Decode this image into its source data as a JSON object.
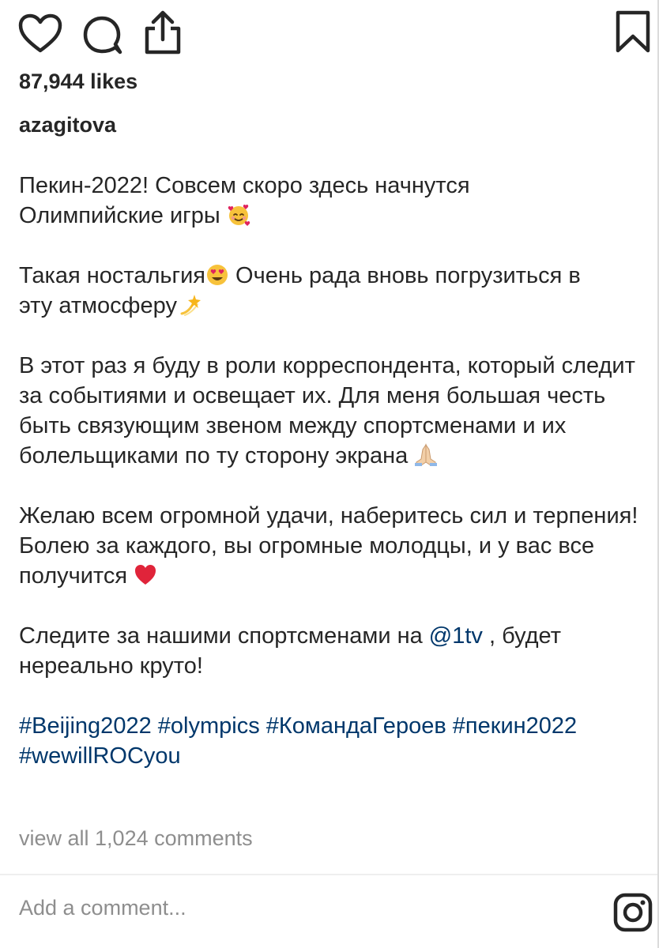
{
  "icons": {
    "like": "heart-icon",
    "comment": "comment-bubble-icon",
    "share": "share-upload-icon",
    "save": "bookmark-icon",
    "instagram": "instagram-icon"
  },
  "post": {
    "likes": "87,944 likes",
    "username": "azagitova",
    "caption": {
      "p1_line1": "Пекин-2022! Совсем скоро здесь начнутся",
      "p1_line2": "Олимпийские игры",
      "p2_a": "Такая ностальгия",
      "p2_b": " Очень рада вновь погрузиться в",
      "p2_c": "эту атмосферу",
      "p3": "В этот раз я буду в роли корреспондента, который следит за событиями и освещает их. Для меня большая честь быть связующим звеном между спортсменами и их болельщиками по ту сторону экрана",
      "p4": "Желаю всем огромной удачи, наберитесь сил и терпения! Болею за каждого, вы огромные молодцы, и у вас все получится",
      "p5_a": "Следите за нашими спортсменами на ",
      "p5_mention": "@1tv",
      "p5_b": " , будет нереально круто!",
      "hashtags": [
        "#Beijing2022",
        "#olympics",
        "#КомандаГероев",
        "#пекин2022",
        "#wewillROCyou"
      ]
    },
    "view_comments": "view all 1,024 comments"
  },
  "comment_box": {
    "placeholder": "Add a comment..."
  },
  "colors": {
    "text": "#262626",
    "link": "#00376b",
    "muted": "#8e8e8e"
  }
}
